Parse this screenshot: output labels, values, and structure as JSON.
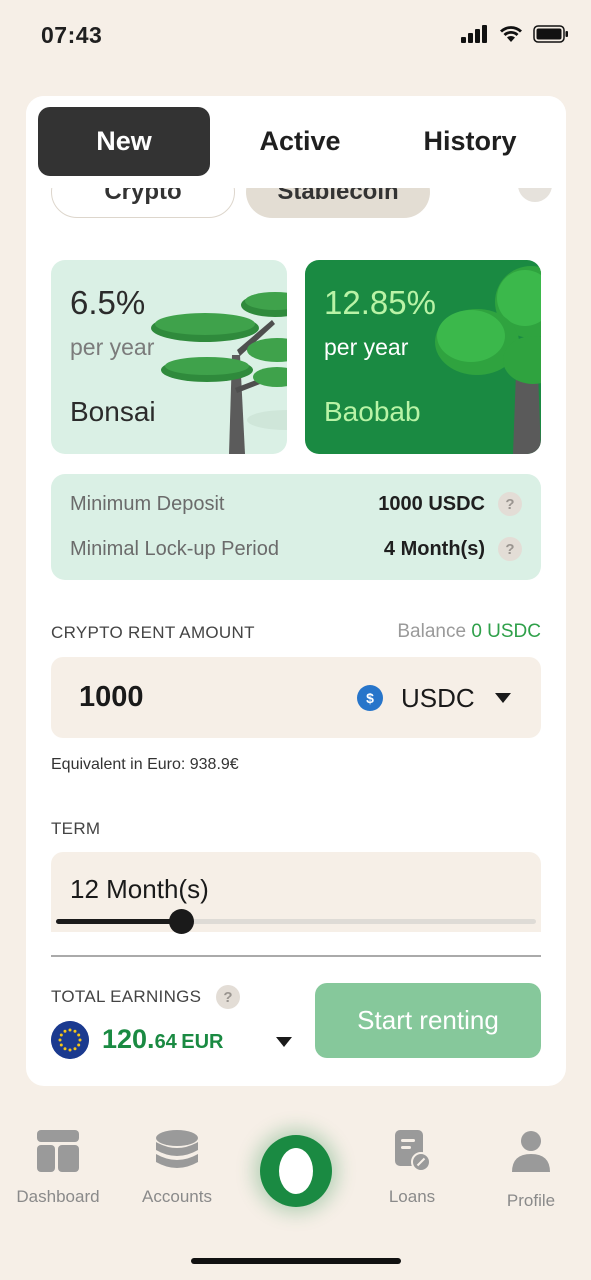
{
  "status_bar": {
    "time": "07:43"
  },
  "tabs": [
    {
      "label": "New",
      "active": true
    },
    {
      "label": "Active",
      "active": false
    },
    {
      "label": "History",
      "active": false
    }
  ],
  "pills": [
    {
      "label": "Crypto"
    },
    {
      "label": "Stablecoin"
    }
  ],
  "plans": [
    {
      "rate": "6.5%",
      "per": "per year",
      "name": "Bonsai"
    },
    {
      "rate": "12.85%",
      "per": "per year",
      "name": "Baobab",
      "selected": true
    }
  ],
  "info": {
    "min_deposit_label": "Minimum Deposit",
    "min_deposit_value": "1000 USDC",
    "lockup_label": "Minimal Lock-up Period",
    "lockup_value": "4 Month(s)",
    "help_glyph": "?"
  },
  "amount": {
    "section_label": "CRYPTO RENT AMOUNT",
    "balance_label": "Balance",
    "balance_value": "0 USDC",
    "value": "1000",
    "currency": "USDC",
    "equivalent": "Equivalent in Euro: 938.9€"
  },
  "term": {
    "section_label": "TERM",
    "value": "12 Month(s)",
    "slider_fraction": 0.26
  },
  "earnings": {
    "section_label": "TOTAL EARNINGS",
    "value_main": "120.",
    "value_decimal": "64",
    "currency": "EUR",
    "start_label": "Start renting"
  },
  "nav": [
    {
      "label": "Dashboard",
      "icon": "dashboard-icon"
    },
    {
      "label": "Accounts",
      "icon": "coins-stack-icon"
    },
    {
      "label": "",
      "icon": "home-logo-icon"
    },
    {
      "label": "Loans",
      "icon": "document-percent-icon"
    },
    {
      "label": "Profile",
      "icon": "user-icon"
    }
  ],
  "colors": {
    "accent_green": "#1a8a42",
    "light_green": "#daf0e5",
    "beige": "#f6efe7",
    "button_disabled": "#86c89b",
    "usdc_blue": "#2775ca"
  }
}
